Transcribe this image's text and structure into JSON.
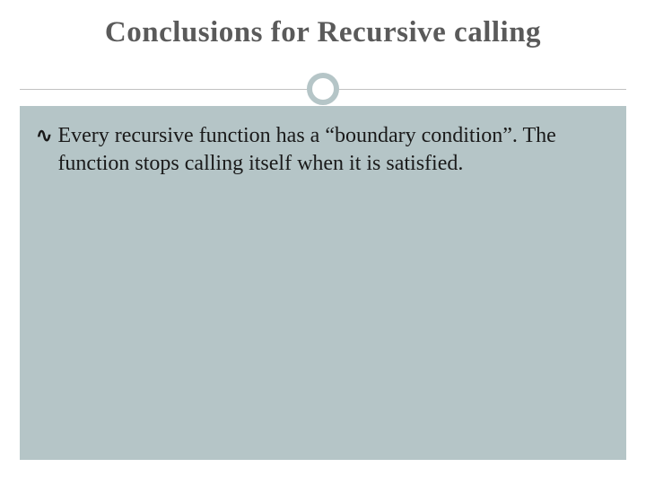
{
  "slide": {
    "title": "Conclusions for Recursive calling",
    "bullets": [
      {
        "icon": "curl-bullet",
        "text": "Every recursive function has a “boundary condition”. The function stops calling itself when it is satisfied."
      }
    ]
  }
}
